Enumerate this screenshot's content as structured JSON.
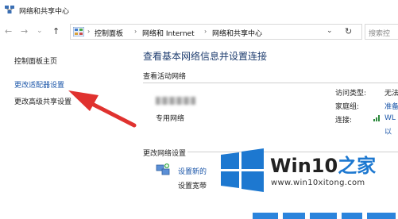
{
  "window": {
    "title": "网络和共享中心"
  },
  "nav": {
    "back": "←",
    "forward": "→",
    "history": "⌄",
    "up": "↑"
  },
  "address": {
    "crumbs": [
      "控制面板",
      "网络和 Internet",
      "网络和共享中心"
    ],
    "sep": "›",
    "dropdown": "⌄",
    "refresh": "↻"
  },
  "search": {
    "placeholder": "搜索控"
  },
  "sidebar": {
    "items": [
      "控制面板主页",
      "更改适配器设置",
      "更改高级共享设置"
    ]
  },
  "main": {
    "title": "查看基本网络信息并设置连接",
    "active_section": "查看活动网络",
    "network_type": "专用网络",
    "props": [
      {
        "label": "访问类型:",
        "value": "无法"
      },
      {
        "label": "家庭组:",
        "value": "准备"
      },
      {
        "label": "连接:",
        "value": "WL"
      }
    ],
    "prop_extra": "以",
    "change_section": "更改网络设置",
    "setting_link": "设置新的",
    "setting_desc": "设置宽带"
  },
  "watermark": {
    "brand_a": "Win10",
    "brand_b": "之家",
    "url": "www.win10xitong.com"
  },
  "colors": {
    "link": "#1a55a8",
    "title": "#1e3d6f",
    "arrow": "#e0322f",
    "win_blue": "#1d78d0"
  }
}
